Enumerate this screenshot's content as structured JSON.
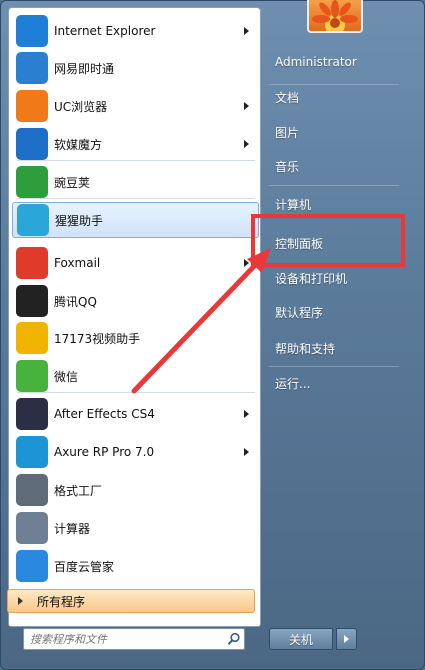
{
  "programs": [
    {
      "label": "Internet Explorer",
      "icon": "internet-explorer-icon",
      "color": "#1f7fd8",
      "arrow": true
    },
    {
      "label": "网易即时通",
      "icon": "netease-popo-icon",
      "color": "#2b7fd0",
      "arrow": false
    },
    {
      "label": "UC浏览器",
      "icon": "uc-browser-icon",
      "color": "#f07a1a",
      "arrow": true
    },
    {
      "label": "软媒魔方",
      "icon": "ruanmei-mofang-icon",
      "color": "#1c6ec6",
      "arrow": true
    },
    {
      "label": "豌豆荚",
      "icon": "wandoujia-icon",
      "color": "#2e9d3c",
      "arrow": false
    },
    {
      "label": "猩猩助手",
      "icon": "xingxing-assistant-icon",
      "color": "#2aa6d8",
      "arrow": false
    },
    {
      "label": "Foxmail",
      "icon": "foxmail-icon",
      "color": "#e03a2a",
      "arrow": true
    },
    {
      "label": "腾讯QQ",
      "icon": "qq-penguin-icon",
      "color": "#222222",
      "arrow": false
    },
    {
      "label": "17173视频助手",
      "icon": "video-17173-icon",
      "color": "#f0b400",
      "arrow": false
    },
    {
      "label": "微信",
      "icon": "wechat-icon",
      "color": "#46b23c",
      "arrow": false
    },
    {
      "label": "After Effects CS4",
      "icon": "after-effects-icon",
      "color": "#2b2f45",
      "arrow": true
    },
    {
      "label": "Axure RP Pro 7.0",
      "icon": "axure-icon",
      "color": "#1d95d4",
      "arrow": true
    },
    {
      "label": "格式工厂",
      "icon": "format-factory-icon",
      "color": "#5f6b78",
      "arrow": false
    },
    {
      "label": "计算器",
      "icon": "calculator-icon",
      "color": "#6f7f96",
      "arrow": false
    },
    {
      "label": "百度云管家",
      "icon": "baidu-cloud-icon",
      "color": "#2b88e0",
      "arrow": false
    }
  ],
  "all_programs_label": "所有程序",
  "search_placeholder": "搜索程序和文件",
  "right_items": [
    {
      "label": "Administrator"
    },
    {
      "label": "文档"
    },
    {
      "label": "图片"
    },
    {
      "label": "音乐"
    },
    {
      "label": "计算机"
    },
    {
      "label": "控制面板"
    },
    {
      "label": "设备和打印机"
    },
    {
      "label": "默认程序"
    },
    {
      "label": "帮助和支持"
    },
    {
      "label": "运行..."
    }
  ],
  "shutdown_label": "关机",
  "accent_red": "#ea3838"
}
